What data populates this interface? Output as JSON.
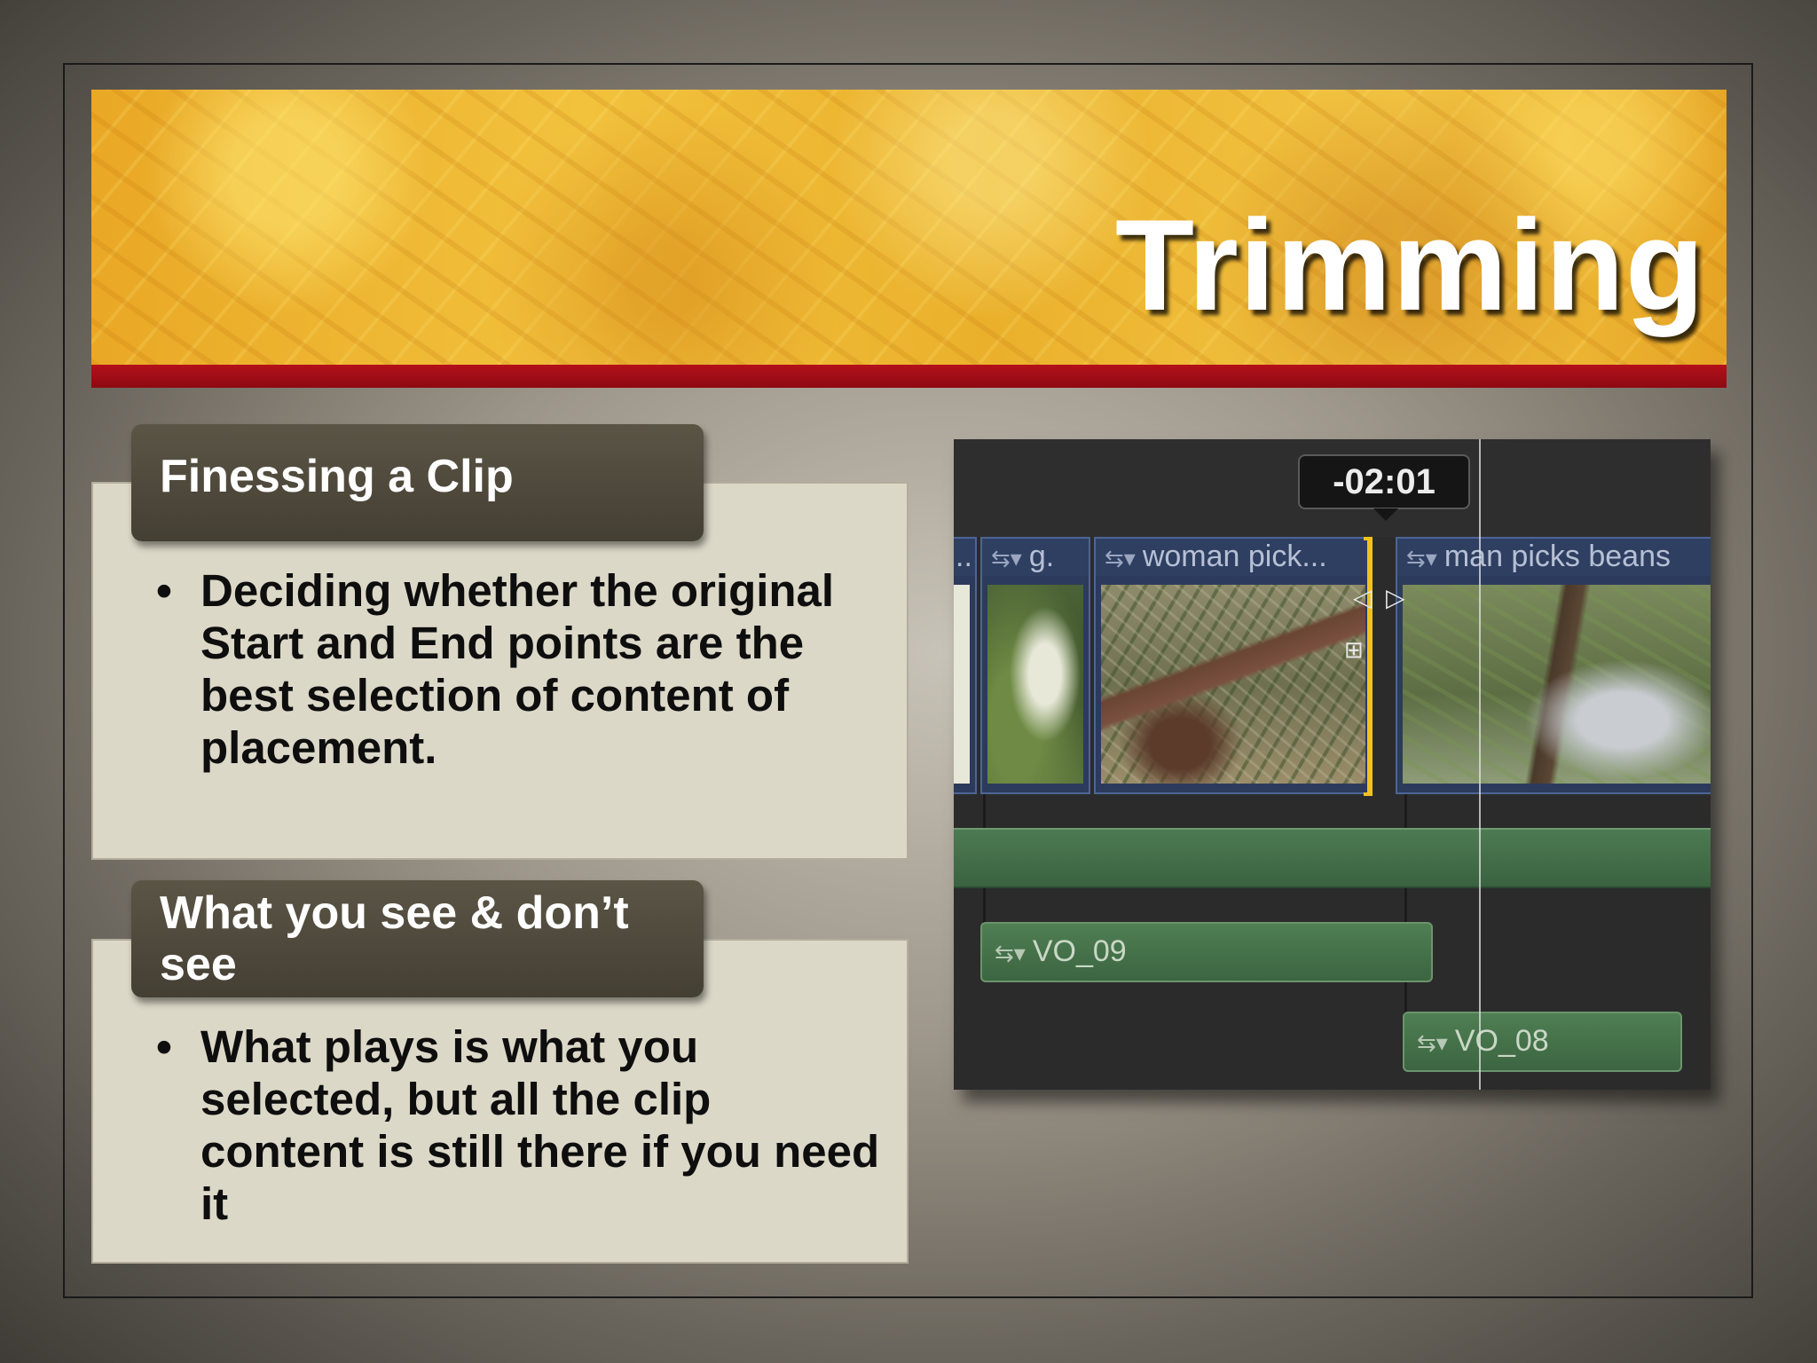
{
  "slide": {
    "title": "Trimming"
  },
  "sections": [
    {
      "heading": "Finessing a Clip",
      "bullet": "Deciding whether the original Start and End points are the best selection of content of placement."
    },
    {
      "heading": "What you see & don’t see",
      "bullet": "What plays is what you selected, but all the clip content is still there if you need it"
    }
  ],
  "timeline": {
    "trim_readout": "-02:01",
    "clips": [
      {
        "label": "..",
        "icon": "clip-menu-icon"
      },
      {
        "label": "g.",
        "icon": "clip-menu-icon"
      },
      {
        "label": "woman pick...",
        "icon": "clip-menu-icon"
      },
      {
        "label": "man picks beans",
        "icon": "clip-menu-icon"
      }
    ],
    "connected_clips": [
      {
        "label": "VO_09",
        "icon": "clip-menu-icon"
      },
      {
        "label": "VO_08",
        "icon": "clip-menu-icon"
      }
    ],
    "colors": {
      "video_clip": "#2c3b5c",
      "audio_clip": "#4d7a52",
      "trim_selection": "#f2c21b",
      "title_banner_bar": "#a00d16"
    }
  }
}
